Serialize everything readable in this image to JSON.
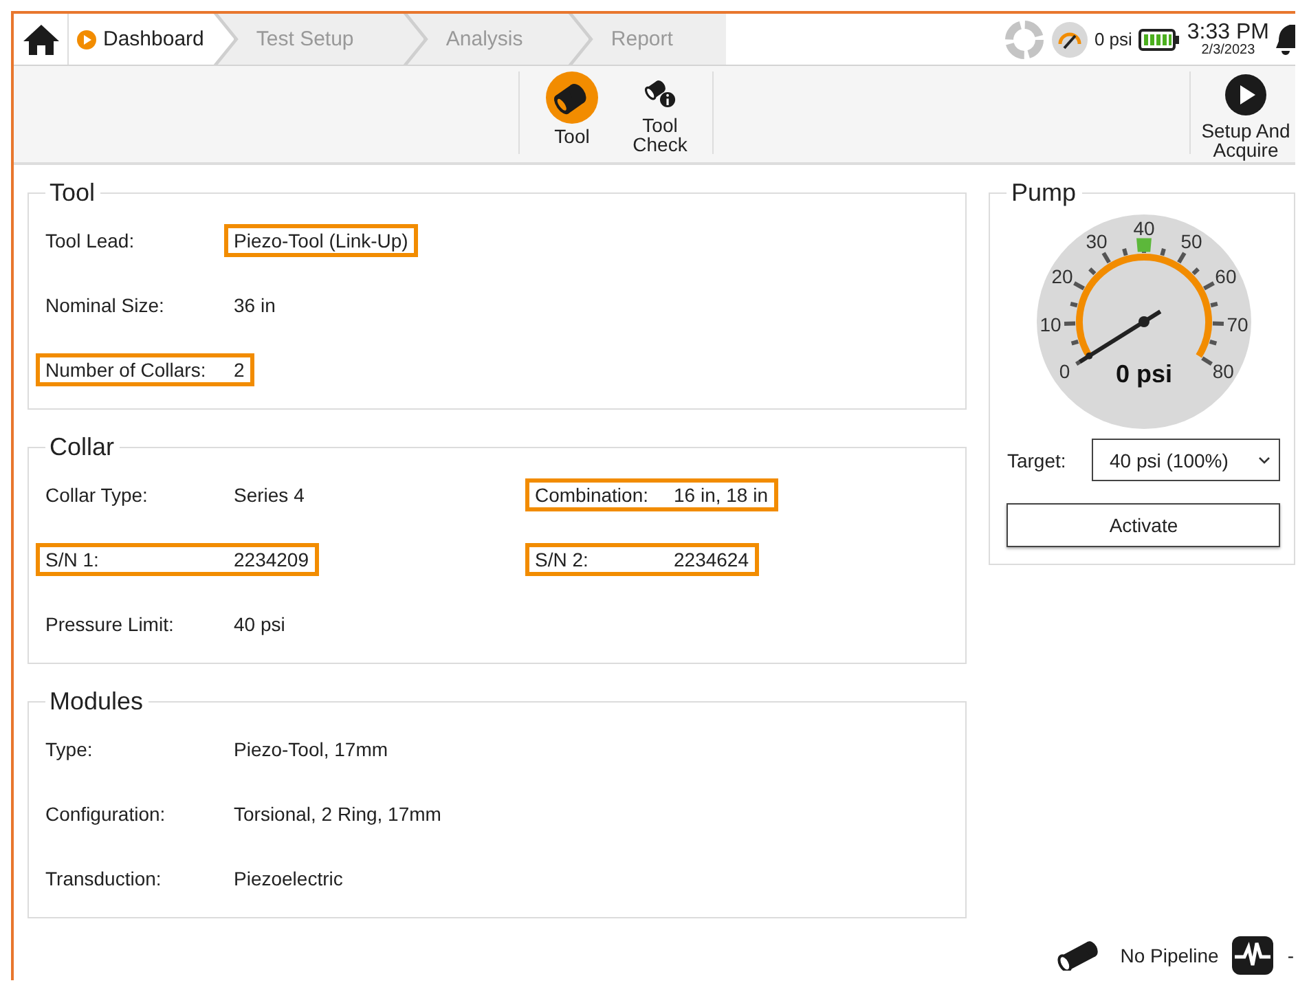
{
  "topbar": {
    "steps": [
      {
        "label": "Dashboard",
        "selected": true
      },
      {
        "label": "Test Setup",
        "selected": false
      },
      {
        "label": "Analysis",
        "selected": false
      },
      {
        "label": "Report",
        "selected": false
      }
    ],
    "pressure": "0 psi",
    "time": "3:33 PM",
    "date": "2/3/2023"
  },
  "toolbar": {
    "buttons": [
      {
        "label": "Tool",
        "kind": "tool",
        "selected": true
      },
      {
        "label": "Tool Check",
        "kind": "tool-check",
        "selected": false
      }
    ],
    "action": {
      "label": "Setup And Acquire"
    }
  },
  "sections": [
    {
      "title": "Tool",
      "rows": [
        [
          {
            "label": "Tool Lead:",
            "value": "Piezo-Tool (Link-Up)",
            "value_outlined": true,
            "field_outlined": false
          }
        ],
        [
          {
            "label": "Nominal Size:",
            "value": "36 in",
            "value_outlined": false,
            "field_outlined": false
          }
        ],
        [
          {
            "label": "Number of Collars:",
            "value": "2",
            "value_outlined": false,
            "field_outlined": true
          }
        ]
      ]
    },
    {
      "title": "Collar",
      "rows": [
        [
          {
            "label": "Collar Type:",
            "value": "Series 4",
            "value_outlined": false,
            "field_outlined": false
          },
          {
            "label": "Combination:",
            "value": "16 in, 18 in",
            "value_outlined": false,
            "field_outlined": true
          }
        ],
        [
          {
            "label": "S/N 1:",
            "value": "2234209",
            "value_outlined": false,
            "field_outlined": true
          },
          {
            "label": "S/N 2:",
            "value": "2234624",
            "value_outlined": false,
            "field_outlined": true
          }
        ],
        [
          {
            "label": "Pressure Limit:",
            "value": "40 psi",
            "value_outlined": false,
            "field_outlined": false
          }
        ]
      ]
    },
    {
      "title": "Modules",
      "rows": [
        [
          {
            "label": "Type:",
            "value": "Piezo-Tool, 17mm",
            "value_outlined": false,
            "field_outlined": false
          }
        ],
        [
          {
            "label": "Configuration:",
            "value": "Torsional, 2 Ring, 17mm",
            "value_outlined": false,
            "field_outlined": false
          }
        ],
        [
          {
            "label": "Transduction:",
            "value": "Piezoelectric",
            "value_outlined": false,
            "field_outlined": false
          }
        ]
      ]
    }
  ],
  "pump": {
    "title": "Pump",
    "gauge": {
      "scale": [
        "0",
        "10",
        "20",
        "30",
        "40",
        "50",
        "60",
        "70",
        "80"
      ],
      "level": 0,
      "reading": "0 psi",
      "target_marker": {
        "level": 0.5
      }
    },
    "target": {
      "label": "Target:",
      "value": "40 psi (100%)"
    },
    "button": "Activate"
  },
  "footer": {
    "pipeline": "No Pipeline",
    "trailing": "-"
  }
}
